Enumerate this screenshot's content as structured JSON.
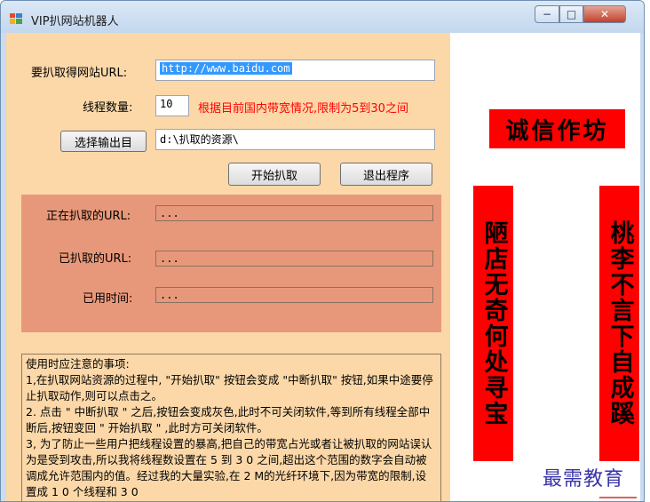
{
  "window": {
    "title": "VIP扒网站机器人",
    "minimize": "−",
    "maximize": "□",
    "close": "✕"
  },
  "form": {
    "url_label": "要扒取得网站URL:",
    "url_value": "http://www.baidu.com",
    "threads_label": "线程数量:",
    "threads_value": "10",
    "threads_note": "根据目前国内带宽情况,限制为5到30之间",
    "output_button": "选择输出目",
    "output_value": "d:\\扒取的资源\\",
    "start_button": "开始扒取",
    "exit_button": "退出程序"
  },
  "status": {
    "current_label": "正在扒取的URL:",
    "current_value": "...",
    "done_label": "已扒取的URL:",
    "done_value": "...",
    "elapsed_label": "已用时间:",
    "elapsed_value": "..."
  },
  "notes": [
    "使用时应注意的事项:",
    "1,在扒取网站资源的过程中, \"开始扒取\" 按钮会变成 \"中断扒取\" 按钮,如果中途要停止扒取动作,则可以点击之。",
    "2. 点击 \" 中断扒取 \" 之后,按钮会变成灰色,此时不可关闭软件,等到所有线程全部中断后,按钮变回 \" 开始扒取 \" ,此时方可关闭软件。",
    "3, 为了防止一些用户把线程设置的暴高,把自己的带宽占光或者让被扒取的网站误认为是受到攻击,所以我将线程数设置在 5 到 3 0 之间,超出这个范围的数字会自动被调成允许范围内的值。经过我的大量实验,在 2 M的光纤环境下,因为带宽的限制,设置成 1 0 个线程和 3 0"
  ],
  "decor": {
    "banner": "诚信作坊",
    "scroll_left": "陋店无奇何处寻宝",
    "scroll_right": "桃李不言下自成蹊",
    "watermark": "最需教育"
  }
}
